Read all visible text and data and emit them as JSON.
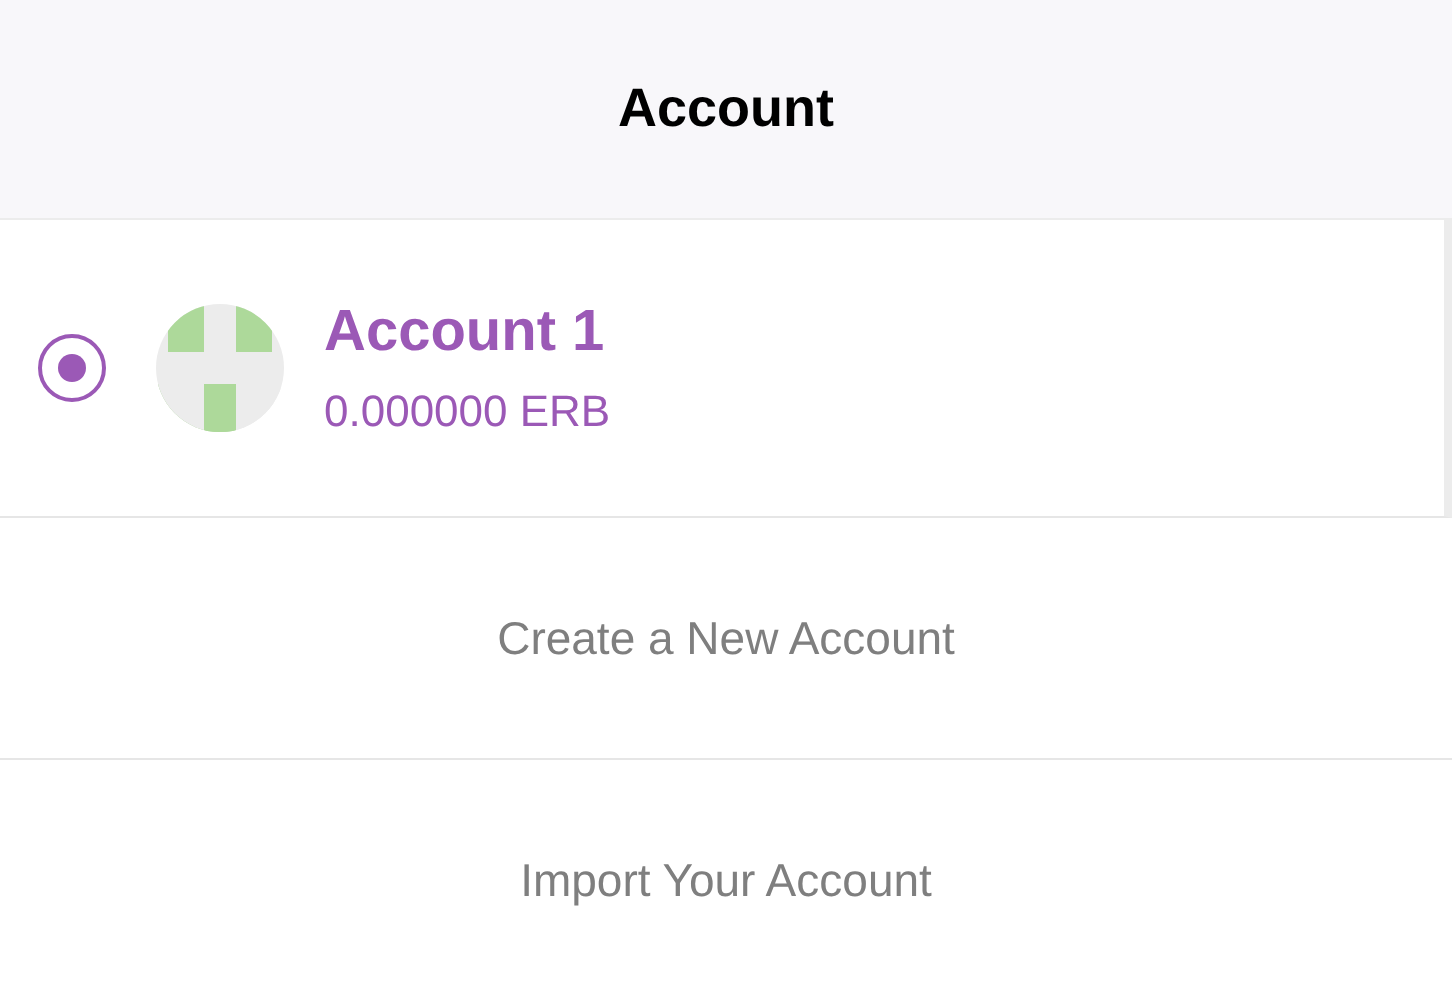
{
  "header": {
    "title": "Account"
  },
  "accounts": [
    {
      "name": "Account 1",
      "balance": "0.000000 ERB",
      "selected": true
    }
  ],
  "actions": [
    "Create a New Account",
    "Import Your Account"
  ]
}
